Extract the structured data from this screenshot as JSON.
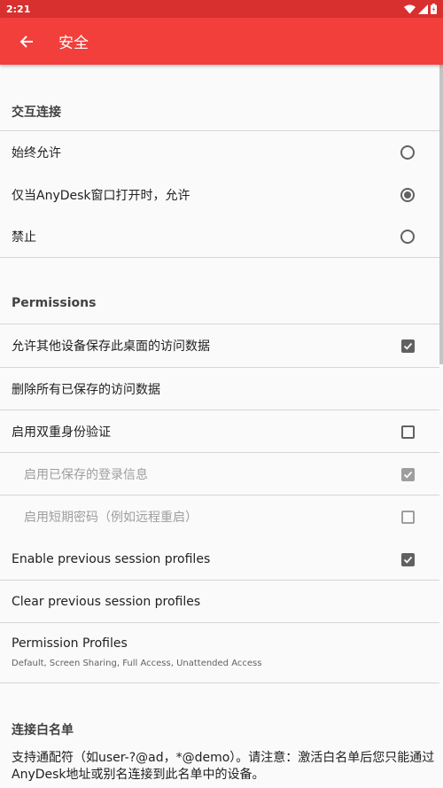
{
  "status": {
    "time": "2:21"
  },
  "appbar": {
    "title": "安全"
  },
  "sections": {
    "interactive": {
      "header": "交互连接",
      "options": [
        {
          "label": "始终允许",
          "selected": false
        },
        {
          "label": "仅当AnyDesk窗口打开时，允许",
          "selected": true
        },
        {
          "label": "禁止",
          "selected": false
        }
      ]
    },
    "permissions": {
      "header": "Permissions",
      "items": [
        {
          "label": "允许其他设备保存此桌面的访问数据",
          "checked": true
        },
        {
          "label": "删除所有已保存的访问数据"
        },
        {
          "label": "启用双重身份验证",
          "checked": false
        },
        {
          "label": "启用已保存的登录信息",
          "checked": true,
          "enabled": false
        },
        {
          "label": "启用短期密码（例如远程重启）",
          "checked": false,
          "enabled": false
        },
        {
          "label": "Enable previous session profiles",
          "checked": true
        },
        {
          "label": "Clear previous session profiles"
        },
        {
          "label": "Permission Profiles",
          "summary": "Default, Screen Sharing, Full Access, Unattended Access"
        }
      ]
    },
    "whitelist": {
      "header": "连接白名单",
      "description": "支持通配符（如user-?@ad，*@demo）。请注意：激活白名单后您只能通过AnyDesk地址或别名连接到此名单中的设备。"
    }
  },
  "colors": {
    "appbar": "#f23f3c",
    "statusbar": "#d8302f"
  }
}
